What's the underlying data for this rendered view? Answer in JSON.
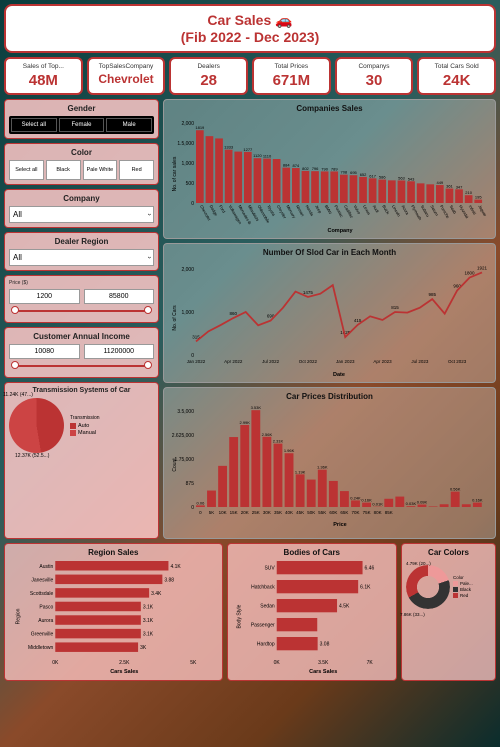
{
  "header": {
    "title1": "Car Sales 🚗",
    "title2": "(Fib 2022 - Dec 2023)"
  },
  "kpis": [
    {
      "label": "Sales of Top...",
      "value": "48M"
    },
    {
      "label": "TopSalesCompany",
      "value": "Chevrolet"
    },
    {
      "label": "Dealers",
      "value": "28"
    },
    {
      "label": "Total Prices",
      "value": "671M"
    },
    {
      "label": "Companys",
      "value": "30"
    },
    {
      "label": "Total Cars Sold",
      "value": "24K"
    }
  ],
  "filters": {
    "gender": {
      "title": "Gender",
      "buttons": [
        "Select all",
        "Female",
        "Male"
      ]
    },
    "color": {
      "title": "Color",
      "buttons": [
        "Select all",
        "Black",
        "Pale White",
        "Red"
      ]
    },
    "company": {
      "title": "Company",
      "value": "All"
    },
    "region": {
      "title": "Dealer Region",
      "value": "All"
    },
    "price": {
      "title": "Price ($)",
      "min": "1200",
      "max": "85800"
    },
    "income": {
      "title": "Customer Annual Income",
      "min": "10080",
      "max": "11200000"
    }
  },
  "trans_pie": {
    "title": "Transmission Systems of Car",
    "legend_title": "Transmission",
    "items": [
      {
        "name": "Auto",
        "pct": "11.24K (47...)",
        "color": "#b33"
      },
      {
        "name": "Manual",
        "pct": "12.37K (52.5...)",
        "color": "#c44"
      }
    ]
  },
  "bottom_titles": {
    "region": "Region Sales",
    "body": "Bodies of Cars",
    "colors": "Car Colors"
  },
  "car_colors": {
    "items": [
      {
        "name": "Pale...",
        "val": "4.79K (20...)",
        "c": "#e99"
      },
      {
        "name": "Black",
        "val": "",
        "c": "#333"
      },
      {
        "name": "Red",
        "val": "7.86K (33...)",
        "c": "#b33"
      }
    ],
    "legend": "Color"
  },
  "axis": {
    "ylabel_companies": "No. of car sales",
    "xlabel_companies": "Company",
    "ylabel_month": "No. of Cars",
    "xlabel_month": "Date",
    "ylabel_price": "Count",
    "xlabel_price": "Price",
    "ylabel_region": "Region",
    "xlabel_region": "Cars Sales",
    "ylabel_body": "Body Style",
    "xlabel_body": "Cars Sales"
  },
  "chart_data": [
    {
      "type": "bar",
      "title": "Companies Sales",
      "xlabel": "Company",
      "ylabel": "No. of car sales",
      "ylim": [
        0,
        2000
      ],
      "categories": [
        "Chevrolet",
        "Dodge",
        "Ford",
        "Volkswagen",
        "Mercedes-B",
        "Mitsubishi",
        "Oldsmobile",
        "Toyota",
        "Chrysler",
        "Mercury",
        "Nissan",
        "Honda",
        "Jeep",
        "BMW",
        "Pontiac",
        "Cadillac",
        "Volvo",
        "Lexus",
        "Audi",
        "Buick",
        "Lincoln",
        "Acura",
        "Plymouth",
        "Subaru",
        "Saturn",
        "Porsche",
        "Saab",
        "Hyundai",
        "Infiniti",
        "Jaguar"
      ],
      "values": [
        1819,
        1671,
        1614,
        1333,
        1285,
        1277,
        1120,
        1110,
        1100,
        884,
        874,
        802,
        796,
        790,
        789,
        708,
        695,
        652,
        617,
        586,
        566,
        563,
        543,
        491,
        467,
        449,
        361,
        342,
        195,
        85
      ],
      "labels": [
        "1819",
        "",
        "",
        "1333",
        "",
        "1277",
        "1120",
        "1110",
        "",
        "884",
        "874",
        "802",
        "796",
        "790",
        "789",
        "708",
        "695",
        "652",
        "617",
        "586",
        "",
        "563",
        "543",
        "",
        "",
        "449",
        "361",
        "347",
        "210",
        "195",
        "85"
      ]
    },
    {
      "type": "line",
      "title": "Number Of Slod Car in Each Month",
      "xlabel": "Date",
      "ylabel": "No. of Cars",
      "ylim": [
        0,
        2000
      ],
      "x": [
        "Jan 2022",
        "Feb 2022",
        "Mar 2022",
        "Apr 2022",
        "May 2022",
        "Jun 2022",
        "Jul 2022",
        "Aug 2022",
        "Sep 2022",
        "Oct 2022",
        "Nov 2022",
        "Dec 2022",
        "Jan 2023",
        "Feb 2023",
        "Mar 2023",
        "Apr 2023",
        "May 2023",
        "Jun 2023",
        "Jul 2023",
        "Aug 2023",
        "Sep 2023",
        "Oct 2023",
        "Nov 2023",
        "Dec 2023"
      ],
      "values": [
        315,
        550,
        700,
        860,
        1000,
        690,
        800,
        1100,
        1475,
        1350,
        1425,
        1625,
        415,
        700,
        900,
        815,
        1000,
        985,
        1100,
        1300,
        960,
        1500,
        1800,
        1921
      ],
      "point_labels": {
        "0": "315",
        "3": "860",
        "6": "690",
        "9": "1475",
        "12": "1625",
        "13": "415",
        "16": "815",
        "19": "985",
        "21": "960",
        "23": "1921",
        "22": "1800"
      }
    },
    {
      "type": "bar",
      "title": "Car Prices Distribution",
      "xlabel": "Price",
      "ylabel": "Count",
      "ylim": [
        0,
        3500
      ],
      "categories": [
        "0",
        "5K",
        "10K",
        "15K",
        "20K",
        "25K",
        "30K",
        "35K",
        "40K",
        "45K",
        "50K",
        "55K",
        "60K",
        "65K",
        "70K",
        "75K",
        "80K",
        "85K"
      ],
      "values": [
        60,
        600,
        1500,
        2550,
        2990,
        3530,
        2560,
        2310,
        1960,
        1190,
        1000,
        1360,
        950,
        580,
        240,
        160,
        10,
        300,
        380,
        30,
        90,
        20,
        100,
        560,
        100,
        160
      ],
      "labels": [
        "0.06",
        "",
        "",
        "",
        "2.99K",
        "3.53K",
        "2.56K",
        "2.31K",
        "1.96K",
        "1.19K",
        "",
        "1.36K",
        "",
        "",
        "0.24K",
        "0.16K",
        "0.01K",
        "",
        "",
        "0.03K",
        "0.09K",
        "",
        "",
        "0.56K",
        "",
        "0.16K"
      ]
    },
    {
      "type": "bar",
      "orientation": "horizontal",
      "title": "Region Sales",
      "xlabel": "Cars Sales",
      "ylabel": "Region",
      "xlim": [
        0,
        5000
      ],
      "categories": [
        "Austin",
        "Janesville",
        "Scottsdale",
        "Pasco",
        "Aurora",
        "Greenville",
        "Middletown"
      ],
      "values": [
        4100,
        3880,
        3400,
        3100,
        3100,
        3100,
        3000
      ],
      "labels": [
        "4.1K",
        "3.88",
        "3.4K",
        "3.1K",
        "3.1K",
        "3.1K",
        "3K"
      ]
    },
    {
      "type": "bar",
      "orientation": "horizontal",
      "title": "Bodies of Cars",
      "xlabel": "Cars Sales",
      "ylabel": "Body Style",
      "xlim": [
        0,
        7000
      ],
      "categories": [
        "SUV",
        "Hatchback",
        "Sedan",
        "Passenger",
        "Hardtop"
      ],
      "values": [
        6460,
        6130,
        4540,
        3050,
        3080
      ],
      "labels": [
        "6.46",
        "6.1K",
        "4.5K",
        "",
        "3.08"
      ]
    },
    {
      "type": "pie",
      "title": "Car Colors",
      "series": [
        {
          "name": "Pale...",
          "value": 4790,
          "label": "4.79K (20...)"
        },
        {
          "name": "Black",
          "value": 11000
        },
        {
          "name": "Red",
          "value": 7860,
          "label": "7.86K (33...)"
        }
      ]
    },
    {
      "type": "pie",
      "title": "Transmission Systems of Car",
      "series": [
        {
          "name": "Auto",
          "value": 11240,
          "label": "11.24K (47...)"
        },
        {
          "name": "Manual",
          "value": 12370,
          "label": "12.37K (52.5...)"
        }
      ]
    }
  ]
}
